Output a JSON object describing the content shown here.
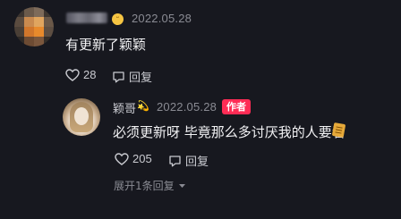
{
  "comment": {
    "date": "2022.05.28",
    "text": "有更新了颖颖",
    "likes": "28",
    "reply_label": "回复"
  },
  "reply": {
    "username": "颖哥",
    "date": "2022.05.28",
    "author_badge": "作者",
    "text": "必须更新呀 毕竟那么多讨厌我的人要看",
    "likes": "205",
    "reply_label": "回复"
  },
  "expand_label": "展开1条回复",
  "colors": {
    "background": "#17181f",
    "badge": "#fe2c55",
    "muted": "#8a8b93"
  },
  "icons": [
    "heart-icon",
    "comment-bubble-icon",
    "chevron-down-icon"
  ]
}
